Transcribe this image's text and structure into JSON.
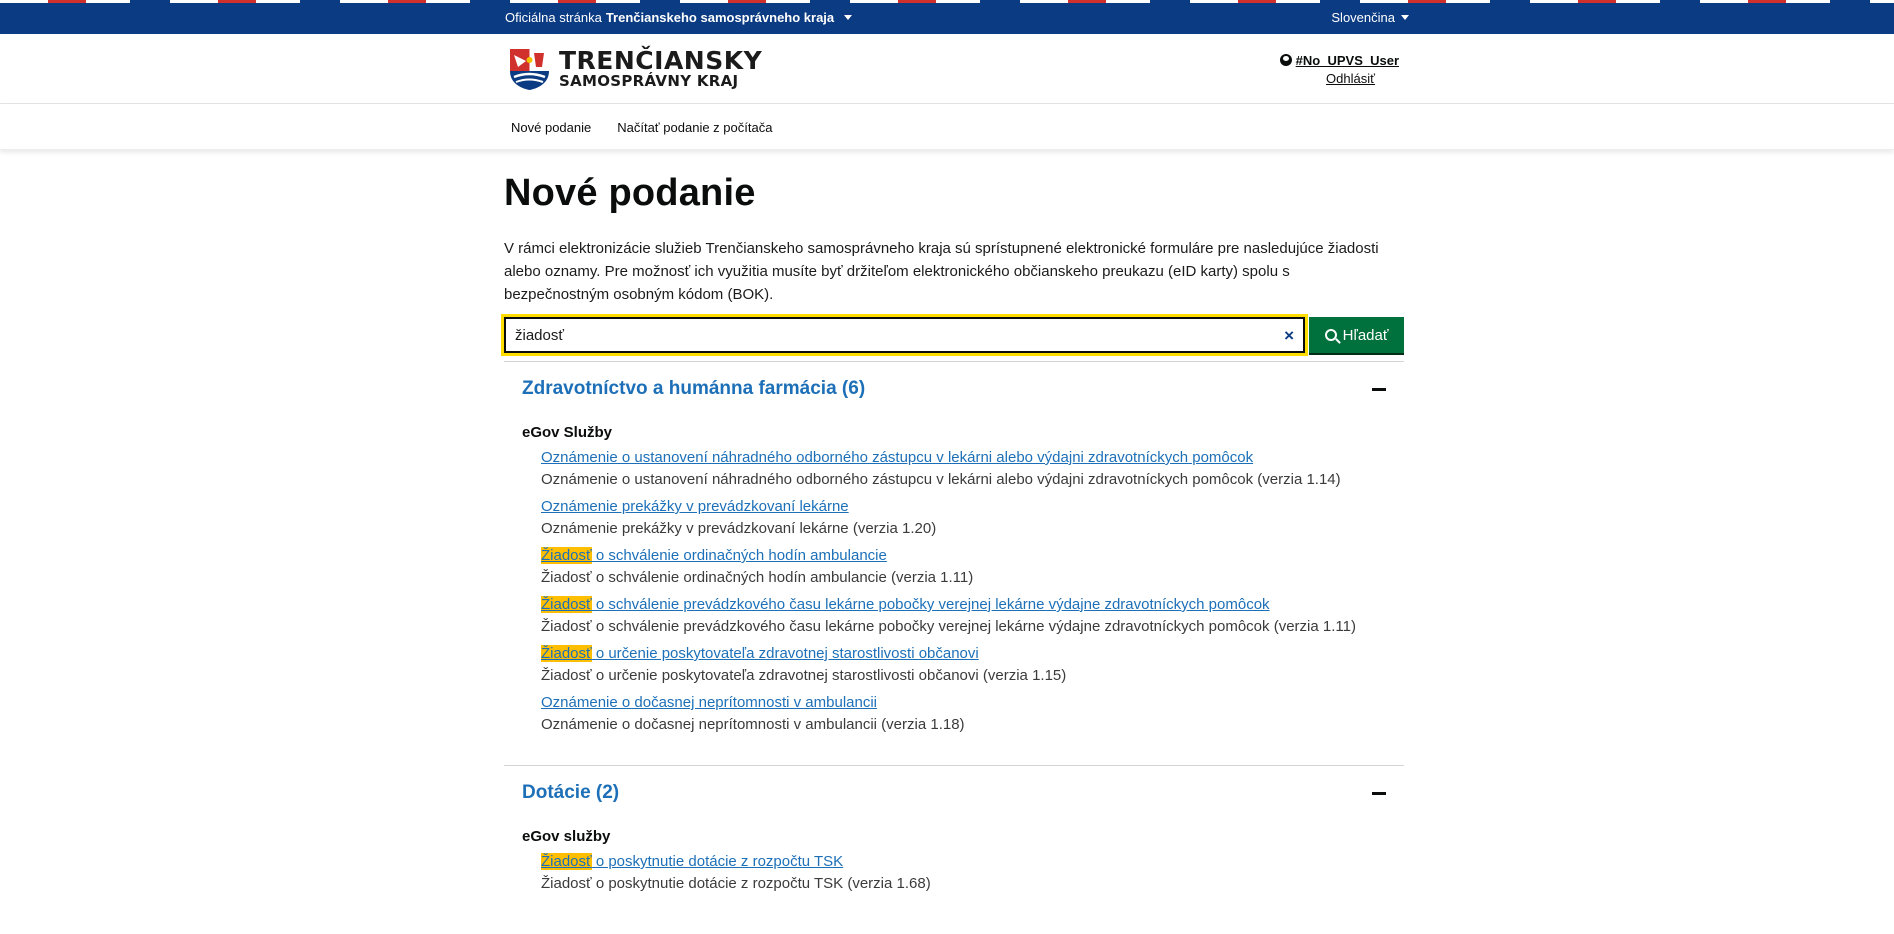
{
  "topbar": {
    "official_prefix": "Oficiálna stránka",
    "official_bold": "Trenčianskeho samosprávneho kraja",
    "language": "Slovenčina"
  },
  "header": {
    "logo_line1": "TRENČIANSKY",
    "logo_line2": "SAMOSPRÁVNY KRAJ",
    "user_name": "#No_UPVS_User",
    "logout": "Odhlásiť"
  },
  "nav": {
    "items": [
      "Nové podanie",
      "Načítať podanie z počítača"
    ]
  },
  "main": {
    "title": "Nové podanie",
    "intro": "V rámci elektronizácie služieb Trenčianskeho samosprávneho kraja sú sprístupnené elektronické formuláre pre nasledujúce žiadosti alebo oznamy. Pre možnosť ich využitia musíte byť držiteľom elektronického občianskeho preukazu (eID karty) spolu s bezpečnostným osobným kódom (BOK).",
    "search": {
      "value": "žiadosť",
      "clear": "×",
      "button": "Hľadať"
    }
  },
  "sections": [
    {
      "title": "Zdravotníctvo a humánna farmácia (6)",
      "subtitle": "eGov Služby",
      "items": [
        {
          "highlight": "",
          "link": "Oznámenie o ustanovení náhradného odborného zástupcu v lekárni alebo výdajni zdravotníckych pomôcok",
          "desc": "Oznámenie o ustanovení náhradného odborného zástupcu v lekárni alebo výdajni zdravotníckych pomôcok (verzia 1.14)"
        },
        {
          "highlight": "",
          "link": "Oznámenie prekážky v prevádzkovaní lekárne",
          "desc": "Oznámenie prekážky v prevádzkovaní lekárne (verzia 1.20)"
        },
        {
          "highlight": "Žiadosť",
          "link": " o schválenie ordinačných hodín ambulancie",
          "desc": "Žiadosť o schválenie ordinačných hodín ambulancie (verzia 1.11)"
        },
        {
          "highlight": "Žiadosť",
          "link": " o schválenie prevádzkového času lekárne pobočky verejnej lekárne výdajne zdravotníckych pomôcok",
          "desc": "Žiadosť o schválenie prevádzkového času lekárne pobočky verejnej lekárne výdajne zdravotníckych pomôcok (verzia 1.11)"
        },
        {
          "highlight": "Žiadosť",
          "link": " o určenie poskytovateľa zdravotnej starostlivosti občanovi",
          "desc": "Žiadosť o určenie poskytovateľa zdravotnej starostlivosti občanovi (verzia 1.15)"
        },
        {
          "highlight": "",
          "link": "Oznámenie o dočasnej neprítomnosti v ambulancii",
          "desc": "Oznámenie o dočasnej neprítomnosti v ambulancii (verzia 1.18)"
        }
      ]
    },
    {
      "title": "Dotácie (2)",
      "subtitle": "eGov služby",
      "items": [
        {
          "highlight": "Žiadosť",
          "link": " o poskytnutie dotácie z rozpočtu TSK",
          "desc": "Žiadosť o poskytnutie dotácie z rozpočtu TSK (verzia 1.68)"
        }
      ]
    }
  ],
  "colors": {
    "topbar": "#0b3b82",
    "link": "#1d70b8",
    "button": "#00703c",
    "highlight": "#ffbf00",
    "focus": "#ffdd00"
  }
}
